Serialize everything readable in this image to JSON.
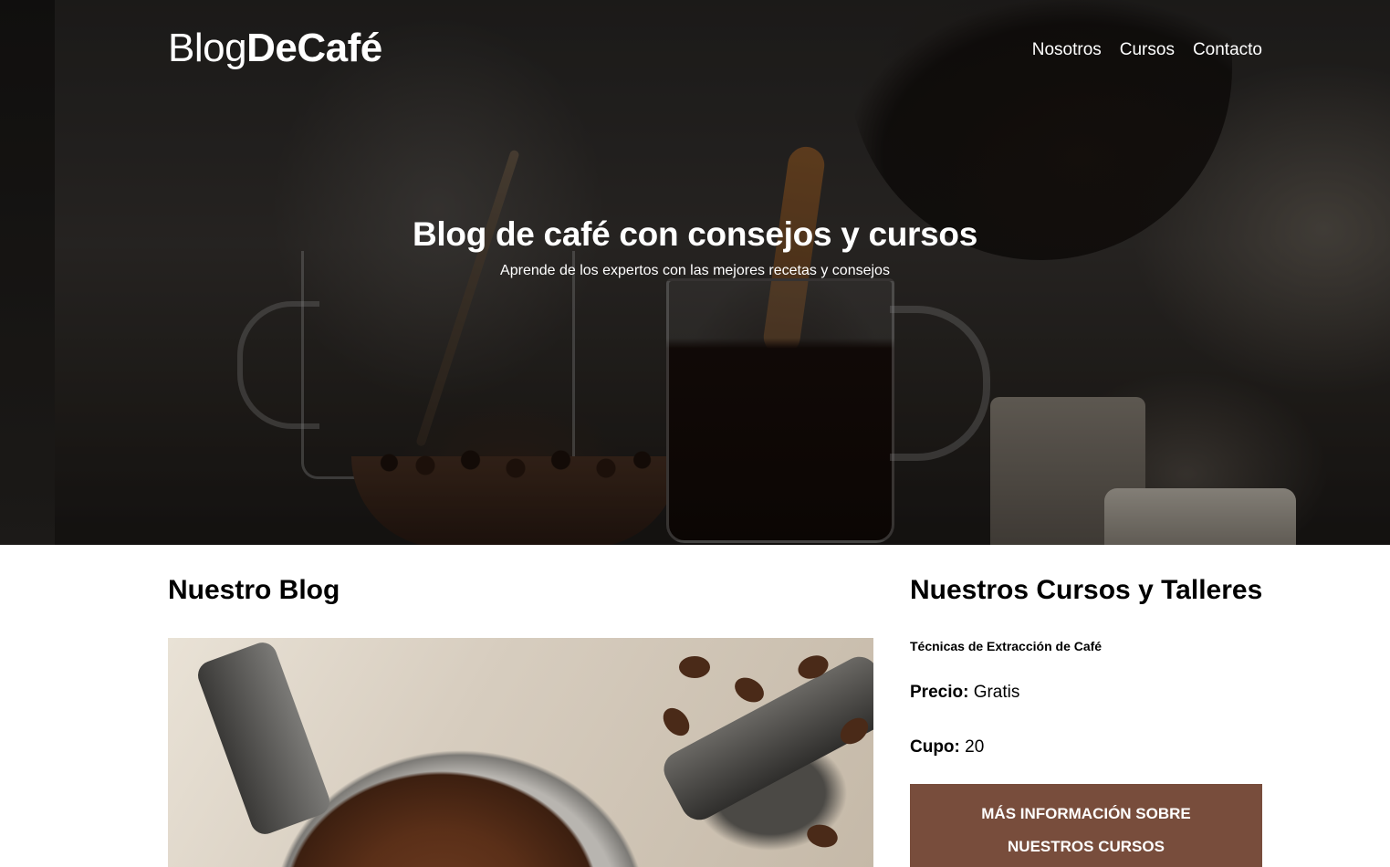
{
  "header": {
    "logo_light": "Blog",
    "logo_bold": "DeCafé",
    "nav": [
      {
        "label": "Nosotros"
      },
      {
        "label": "Cursos"
      },
      {
        "label": "Contacto"
      }
    ]
  },
  "hero": {
    "title": "Blog de café con consejos y cursos",
    "subtitle": "Aprende de los expertos con las mejores recetas y consejos"
  },
  "blog": {
    "title": "Nuestro Blog"
  },
  "courses": {
    "title": "Nuestros Cursos y Talleres",
    "course_name": "Técnicas de Extracción de Café",
    "price_label": "Precio:",
    "price_value": "Gratis",
    "cupo_label": "Cupo:",
    "cupo_value": "20",
    "button_label": "Más Información sobre nuestros cursos"
  },
  "colors": {
    "button_bg": "#784d3c",
    "text": "#000000",
    "hero_text": "#ffffff"
  }
}
